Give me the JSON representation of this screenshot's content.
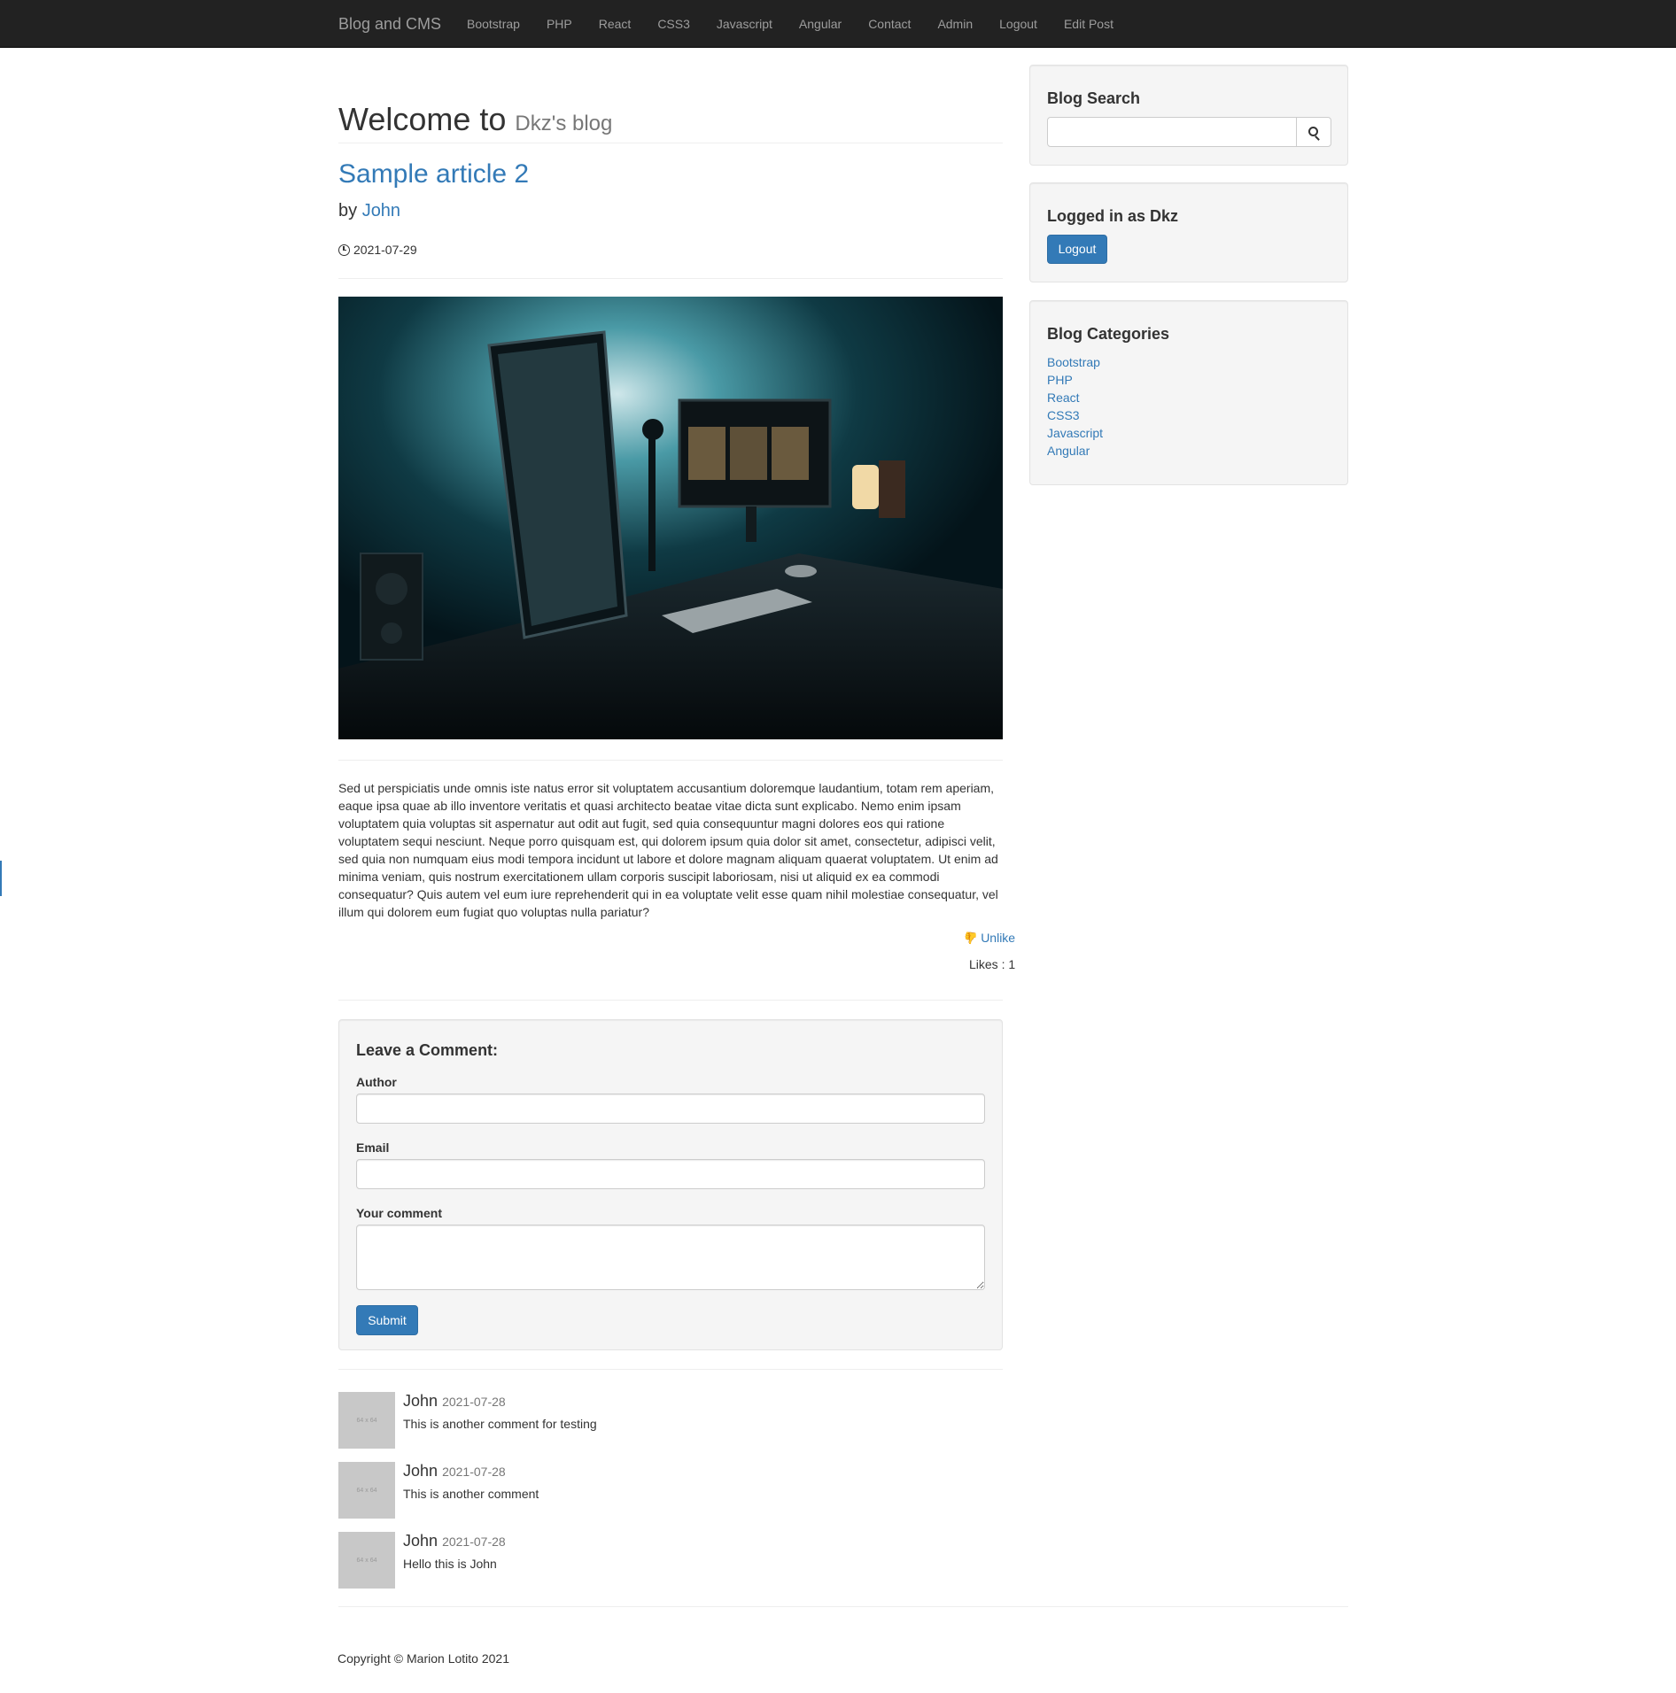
{
  "navbar": {
    "brand": "Blog and CMS",
    "links": [
      "Bootstrap",
      "PHP",
      "React",
      "CSS3",
      "Javascript",
      "Angular",
      "Contact",
      "Admin",
      "Logout",
      "Edit Post"
    ]
  },
  "header": {
    "title": "Welcome to",
    "subtitle": "Dkz's blog"
  },
  "post": {
    "title": "Sample article 2",
    "by_label": "by",
    "author": "John",
    "date": "2021-07-29",
    "date_icon": "clock-icon",
    "image_icon": "desk-photo",
    "body": "Sed ut perspiciatis unde omnis iste natus error sit voluptatem accusantium doloremque laudantium, totam rem aperiam, eaque ipsa quae ab illo inventore veritatis et quasi architecto beatae vitae dicta sunt explicabo. Nemo enim ipsam voluptatem quia voluptas sit aspernatur aut odit aut fugit, sed quia consequuntur magni dolores eos qui ratione voluptatem sequi nesciunt. Neque porro quisquam est, qui dolorem ipsum quia dolor sit amet, consectetur, adipisci velit, sed quia non numquam eius modi tempora incidunt ut labore et dolore magnam aliquam quaerat voluptatem. Ut enim ad minima veniam, quis nostrum exercitationem ullam corporis suscipit laboriosam, nisi ut aliquid ex ea commodi consequatur? Quis autem vel eum iure reprehenderit qui in ea voluptate velit esse quam nihil molestiae consequatur, vel illum qui dolorem eum fugiat quo voluptas nulla pariatur?",
    "unlike_label": "Unlike",
    "likes_text": "Likes : 1"
  },
  "comment_form": {
    "heading": "Leave a Comment:",
    "author_label": "Author",
    "author_value": "",
    "email_label": "Email",
    "email_value": "",
    "comment_label": "Your comment",
    "comment_value": "",
    "submit_label": "Submit"
  },
  "comments": [
    {
      "author": "John",
      "date": "2021-07-28",
      "text": "This is another comment for testing",
      "avatar_text": "64 x 64"
    },
    {
      "author": "John",
      "date": "2021-07-28",
      "text": "This is another comment",
      "avatar_text": "64 x 64"
    },
    {
      "author": "John",
      "date": "2021-07-28",
      "text": "Hello this is John",
      "avatar_text": "64 x 64"
    }
  ],
  "sidebar": {
    "search": {
      "heading": "Blog Search",
      "value": "",
      "button_icon": "search-icon"
    },
    "login": {
      "heading": "Logged in as Dkz",
      "logout_label": "Logout"
    },
    "categories": {
      "heading": "Blog Categories",
      "items": [
        "Bootstrap",
        "PHP",
        "React",
        "CSS3",
        "Javascript",
        "Angular"
      ]
    }
  },
  "footer": {
    "text": "Copyright © Marion Lotito 2021"
  },
  "colors": {
    "navbar_bg": "#222222",
    "link": "#337ab7",
    "well_bg": "#f5f5f5"
  }
}
